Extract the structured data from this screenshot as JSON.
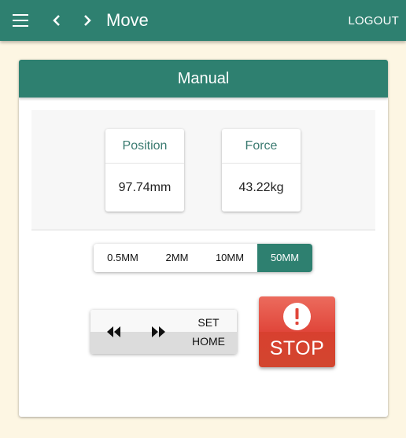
{
  "topbar": {
    "title": "Move",
    "logout_label": "LOGOUT",
    "menu_icon": "hamburger-menu-icon",
    "back_icon": "chevron-left-icon",
    "forward_icon": "chevron-right-icon"
  },
  "card": {
    "title": "Manual"
  },
  "readouts": [
    {
      "label": "Position",
      "value": "97.74mm"
    },
    {
      "label": "Force",
      "value": "43.22kg"
    }
  ],
  "step_sizes": {
    "options": [
      "0.5MM",
      "2MM",
      "10MM",
      "50MM"
    ],
    "selected": "50MM"
  },
  "jog": {
    "left_icon": "rewind-icon",
    "right_icon": "fast-forward-icon",
    "set_home_line1": "SET",
    "set_home_line2": "HOME"
  },
  "stop": {
    "label": "STOP",
    "icon": "alert-circle-icon"
  },
  "colors": {
    "primary": "#2e8070",
    "stop": "#e0463a",
    "background": "#fdf6e3"
  }
}
